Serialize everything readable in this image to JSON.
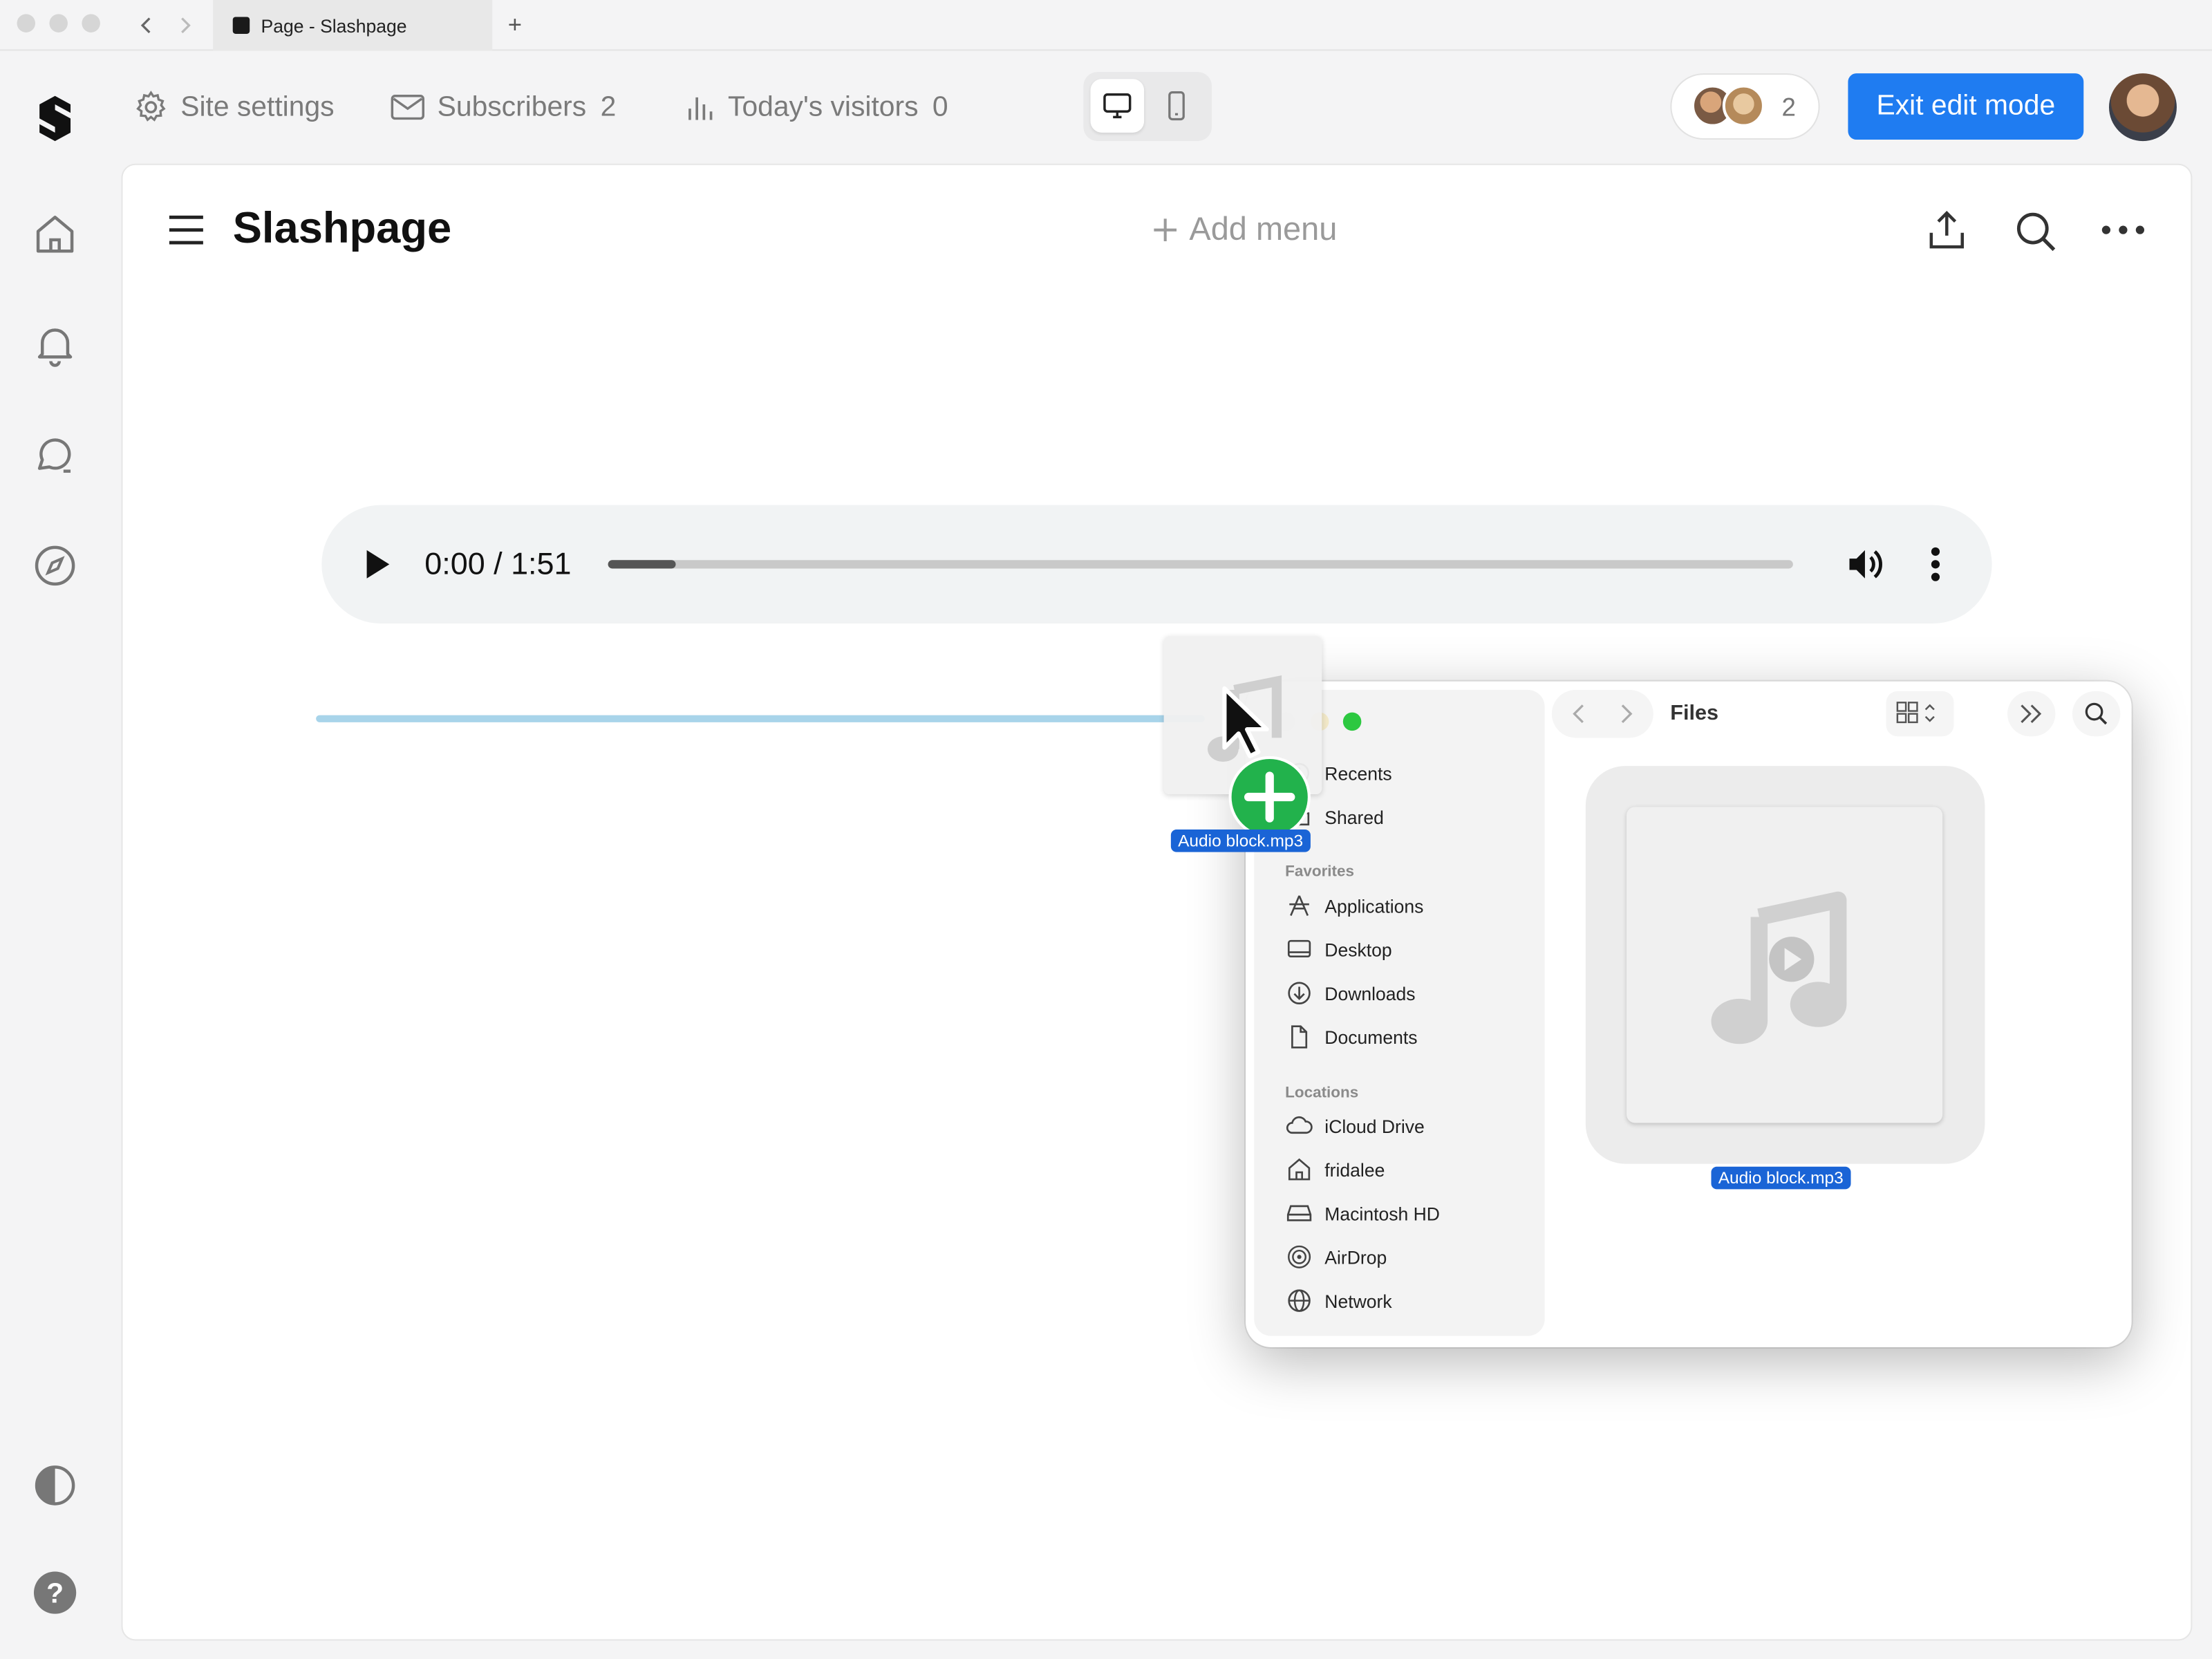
{
  "browser": {
    "tab_title": "Page - Slashpage",
    "new_tab": "+"
  },
  "topbar": {
    "site_settings": "Site settings",
    "subscribers_label": "Subscribers",
    "subscribers_count": "2",
    "visitors_label": "Today's visitors",
    "visitors_count": "0",
    "collaborators_count": "2",
    "exit_edit": "Exit edit mode"
  },
  "page": {
    "title": "Slashpage",
    "add_menu": "Add menu"
  },
  "audio_player": {
    "time": "0:00 / 1:51",
    "progress": 0.057
  },
  "drag": {
    "file_label": "Audio block.mp3"
  },
  "finder": {
    "title": "Files",
    "top_items": [
      "Recents",
      "Shared"
    ],
    "favorites_header": "Favorites",
    "favorites": [
      "Applications",
      "Desktop",
      "Downloads",
      "Documents"
    ],
    "locations_header": "Locations",
    "locations": [
      "iCloud Drive",
      "fridalee",
      "Macintosh HD",
      "AirDrop",
      "Network"
    ],
    "file_name": "Audio block.mp3"
  },
  "colors": {
    "accent": "#1f7cf1",
    "drop_indicator": "#a8d4ea",
    "copy_badge": "#22b24c"
  }
}
